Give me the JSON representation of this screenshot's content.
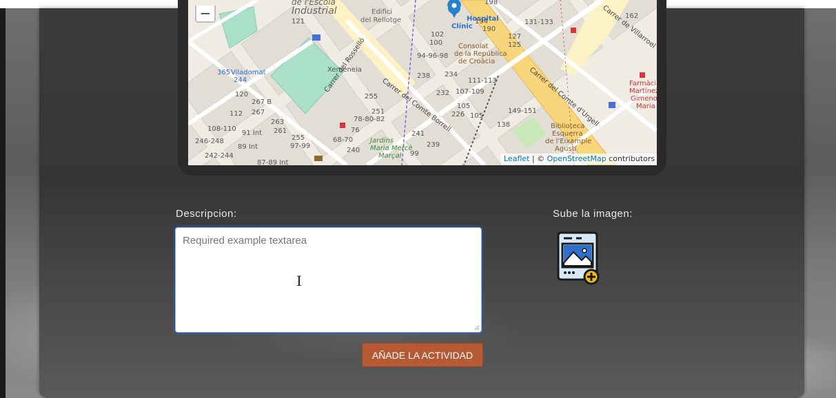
{
  "map": {
    "zoom_out_label": "−",
    "attribution": {
      "leaflet": "Leaflet",
      "separator": " | © ",
      "osm": "OpenStreetMap",
      "suffix": " contributors"
    },
    "labels": {
      "escola": "de l'Escola",
      "industrial": "Industrial",
      "edifici": "Edifici",
      "rellotge": "del Rellotge",
      "hospital": "Hospital",
      "clinic": "Clínic",
      "consolat": "Consolat",
      "republica": "de la República",
      "croacia": "de Croàcia",
      "xemeneia": "Xemeneia",
      "viladomat": "Viladomat",
      "rossello": "Carrer del Rosselló",
      "borrell": "Carrer del Comte Borrell",
      "urgell": "Carrer del Comte d'Urgell",
      "villarroel": "Carrer de Villarroel",
      "jardins": "Jardins",
      "maria_merce": "Maria Mercè",
      "marcal": "Marçal",
      "biblioteca": "Biblioteca",
      "esquerra": "Esquerra",
      "eixample": "de l'Eixample",
      "agusti": "Agustí",
      "farmacia": "Farmàcia",
      "martinez": "Martínez",
      "gimeno": "Gimeno",
      "maria": "Maria",
      "n365": "365",
      "n244": "244",
      "n121": "121",
      "n120": "120",
      "n267b": "267 B",
      "n112": "112",
      "n267": "267",
      "n263": "263",
      "n108": "108-110",
      "n91": "91 Int",
      "n261": "261",
      "n255": "255",
      "n246": "246-248",
      "n89": "89 Int",
      "n97": "97-99",
      "n242": "242-244",
      "n87": "87-89 Int",
      "n102": "102",
      "n100": "100",
      "n94": "94-96-98",
      "n238": "238",
      "n234": "234",
      "n111": "111-113",
      "n232": "232",
      "n107": "107-109",
      "n105": "105",
      "n226": "226",
      "n251": "251",
      "n255b": "255",
      "n78": "78-80-82",
      "n76": "76",
      "n68": "68-70",
      "n240": "240",
      "n241": "241",
      "n239": "239",
      "n99": "99",
      "n198": "198",
      "n194": "194",
      "n190": "190",
      "n131": "131-133",
      "n127": "127",
      "n125": "125",
      "n162": "162",
      "n149": "149-151",
      "n138": "138",
      "n105b": "105"
    }
  },
  "form": {
    "description_label": "Descripcion:",
    "description_placeholder": "Required example textarea",
    "image_label": "Sube la imagen:",
    "submit_label": "AÑADE LA ACTIVIDAD"
  }
}
